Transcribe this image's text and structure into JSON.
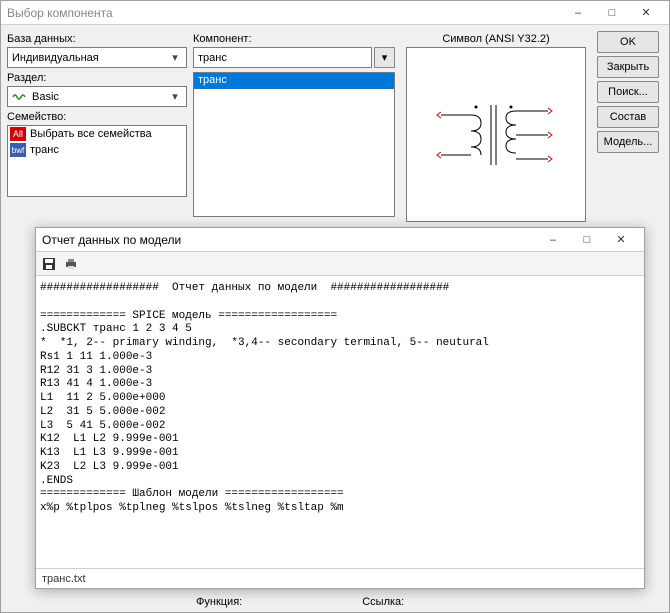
{
  "main": {
    "title": "Выбор компонента",
    "db_label": "База данных:",
    "db_value": "Индивидуальная",
    "section_label": "Раздел:",
    "section_value": "Basic",
    "family_label": "Семейство:",
    "families": [
      {
        "icon": "all",
        "icon_text": "All",
        "label": "Выбрать все семейства"
      },
      {
        "icon": "dwf",
        "icon_text": "bwf",
        "label": "транс"
      }
    ],
    "component_label": "Компонент:",
    "component_value": "транс",
    "component_list": [
      "транс"
    ],
    "symbol_label": "Символ (ANSI Y32.2)",
    "buttons": {
      "ok": "OK",
      "close": "Закрыть",
      "search": "Поиск...",
      "detail": "Состав",
      "model": "Модель..."
    },
    "function_label": "Функция:",
    "link_label": "Ссылка:"
  },
  "report": {
    "title": "Отчет данных по модели",
    "status_file": "транс.txt",
    "lines": [
      "##################  Отчет данных по модели  ##################",
      "",
      "============= SPICE модель ==================",
      ".SUBCKT транс 1 2 3 4 5",
      "*  *1, 2-- primary winding,  *3,4-- secondary terminal, 5-- neutural",
      "Rs1 1 11 1.000e-3",
      "R12 31 3 1.000e-3",
      "R13 41 4 1.000e-3",
      "L1  11 2 5.000e+000",
      "L2  31 5 5.000e-002",
      "L3  5 41 5.000e-002",
      "K12  L1 L2 9.999e-001",
      "K13  L1 L3 9.999e-001",
      "K23  L2 L3 9.999e-001",
      ".ENDS",
      "============= Шаблон модели ==================",
      "x%p %tplpos %tplneg %tslpos %tslneg %tsltap %m"
    ]
  }
}
